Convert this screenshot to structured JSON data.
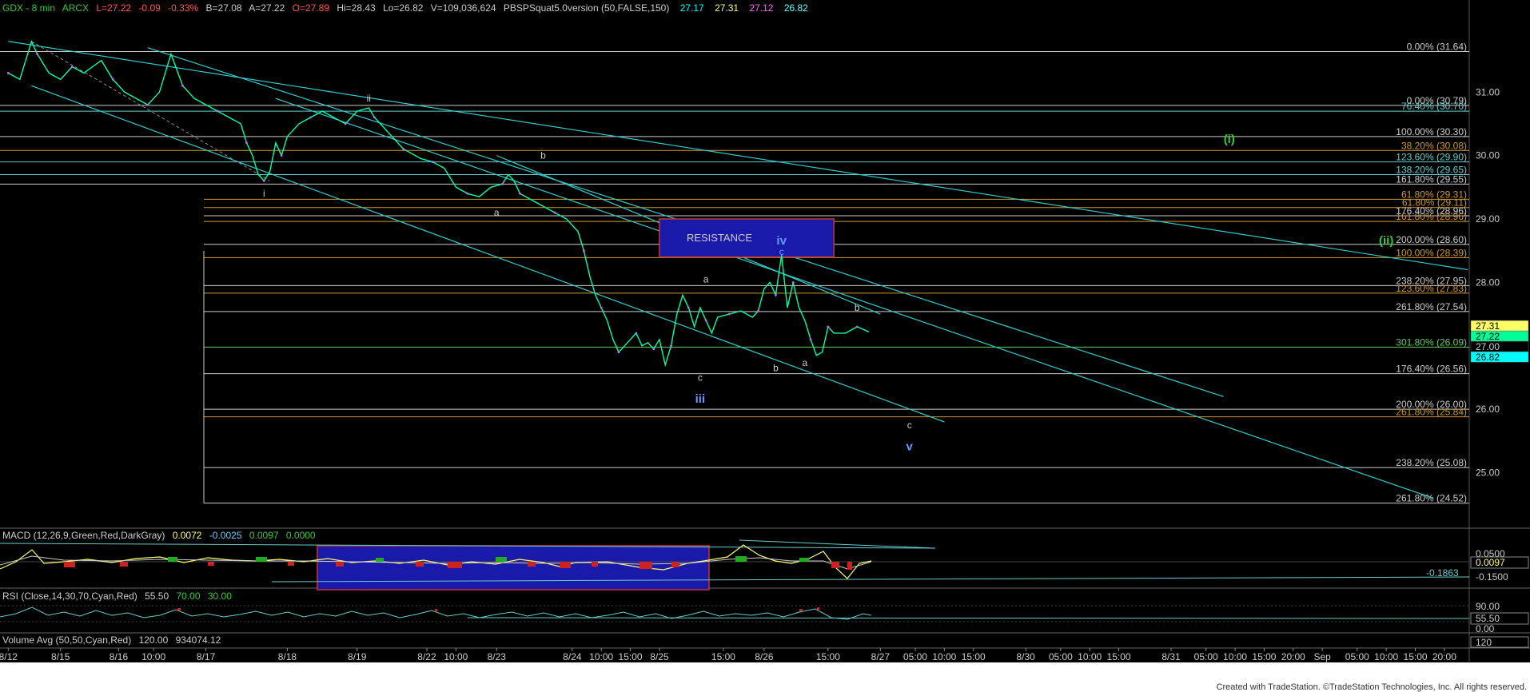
{
  "header": {
    "symbol": "GDX - 8 min",
    "exchange": "ARCX",
    "last": "L=27.22",
    "change": "-0.09",
    "change_pct": "-0.33%",
    "bid": "B=27.08",
    "ask": "A=27.22",
    "open": "O=27.89",
    "high": "Hi=28.43",
    "low": "Lo=26.82",
    "volume": "V=109,036,624",
    "study": "PBSPSquat5.0version (50,FALSE,150)",
    "study_vals": [
      "27.17",
      "27.31",
      "27.12",
      "26.82"
    ],
    "study_colors": [
      "#00ffff",
      "#ffff66",
      "#ff66ff",
      "#66ffff"
    ]
  },
  "chart_data": {
    "type": "line",
    "title": "GDX - 8 min",
    "y_axis": {
      "ylim": [
        24.2,
        32.2
      ],
      "ticks": [
        "31.00",
        "30.00",
        "29.00",
        "28.00",
        "27.00",
        "26.00",
        "25.00"
      ],
      "tick_values": [
        31,
        30,
        29,
        28,
        27,
        26,
        25
      ]
    },
    "x_ticks": [
      "8/12",
      "8/15",
      "8/16",
      "10:00",
      "8/17",
      "8/18",
      "8/19",
      "8/22",
      "10:00",
      "8/23",
      "8/24",
      "10:00",
      "15:00",
      "8/25",
      "15:00",
      "8/26",
      "15:00",
      "8/27",
      "05:00",
      "10:00",
      "15:00",
      "8/30",
      "05:00",
      "10:00",
      "15:00",
      "8/31",
      "05:00",
      "10:00",
      "15:00",
      "20:00",
      "Sep",
      "05:00",
      "10:00",
      "15:00",
      "20:00"
    ],
    "x_tick_values": [
      0,
      9,
      19,
      25,
      34,
      48,
      60,
      72,
      77,
      84,
      97,
      102,
      107,
      112,
      123,
      130,
      141,
      150,
      156,
      161,
      166,
      175,
      181,
      186,
      191,
      200,
      206,
      211,
      216,
      221,
      226,
      232,
      237,
      242,
      247
    ],
    "x_range": [
      -1,
      251
    ],
    "price_series": {
      "name": "GDX",
      "color": "#00ffaa",
      "points": [
        [
          0,
          31.3
        ],
        [
          2,
          31.2
        ],
        [
          4,
          31.8
        ],
        [
          5,
          31.6
        ],
        [
          7,
          31.3
        ],
        [
          9,
          31.2
        ],
        [
          11,
          31.4
        ],
        [
          13,
          31.3
        ],
        [
          16,
          31.5
        ],
        [
          18,
          31.2
        ],
        [
          20,
          31.0
        ],
        [
          22,
          30.9
        ],
        [
          24,
          30.8
        ],
        [
          26,
          31.0
        ],
        [
          28,
          31.6
        ],
        [
          30,
          31.1
        ],
        [
          32,
          30.9
        ],
        [
          34,
          30.8
        ],
        [
          36,
          30.7
        ],
        [
          38,
          30.6
        ],
        [
          40,
          30.5
        ],
        [
          41,
          30.2
        ],
        [
          42,
          30.0
        ],
        [
          43,
          29.7
        ],
        [
          44,
          29.6
        ],
        [
          45,
          29.75
        ],
        [
          46,
          30.2
        ],
        [
          47,
          30.0
        ],
        [
          48,
          30.3
        ],
        [
          50,
          30.5
        ],
        [
          52,
          30.6
        ],
        [
          54,
          30.7
        ],
        [
          56,
          30.6
        ],
        [
          58,
          30.5
        ],
        [
          60,
          30.7
        ],
        [
          62,
          30.75
        ],
        [
          63,
          30.6
        ],
        [
          64,
          30.5
        ],
        [
          66,
          30.3
        ],
        [
          68,
          30.1
        ],
        [
          70,
          30.0
        ],
        [
          71,
          29.95
        ],
        [
          73,
          29.9
        ],
        [
          75,
          29.8
        ],
        [
          77,
          29.5
        ],
        [
          79,
          29.4
        ],
        [
          81,
          29.35
        ],
        [
          83,
          29.5
        ],
        [
          85,
          29.55
        ],
        [
          86,
          29.7
        ],
        [
          87,
          29.6
        ],
        [
          88,
          29.4
        ],
        [
          90,
          29.3
        ],
        [
          92,
          29.2
        ],
        [
          94,
          29.1
        ],
        [
          96,
          29.0
        ],
        [
          98,
          28.8
        ],
        [
          99,
          28.5
        ],
        [
          100,
          28.1
        ],
        [
          101,
          27.8
        ],
        [
          102,
          27.6
        ],
        [
          103,
          27.4
        ],
        [
          104,
          27.1
        ],
        [
          105,
          26.9
        ],
        [
          106,
          27.0
        ],
        [
          107,
          27.1
        ],
        [
          108,
          27.2
        ],
        [
          109,
          27.0
        ],
        [
          110,
          27.05
        ],
        [
          111,
          26.95
        ],
        [
          112,
          27.1
        ],
        [
          113,
          26.7
        ],
        [
          114,
          27.0
        ],
        [
          115,
          27.5
        ],
        [
          116,
          27.8
        ],
        [
          117,
          27.6
        ],
        [
          118,
          27.3
        ],
        [
          119,
          27.6
        ],
        [
          120,
          27.4
        ],
        [
          121,
          27.2
        ],
        [
          122,
          27.45
        ],
        [
          124,
          27.5
        ],
        [
          126,
          27.55
        ],
        [
          128,
          27.45
        ],
        [
          129,
          27.55
        ],
        [
          130,
          27.9
        ],
        [
          131,
          28.0
        ],
        [
          132,
          27.8
        ],
        [
          133,
          28.43
        ],
        [
          134,
          27.6
        ],
        [
          135,
          28.0
        ],
        [
          136,
          27.6
        ],
        [
          137,
          27.4
        ],
        [
          138,
          27.1
        ],
        [
          139,
          26.85
        ],
        [
          140,
          26.9
        ],
        [
          141,
          27.3
        ],
        [
          142,
          27.2
        ],
        [
          144,
          27.2
        ],
        [
          146,
          27.3
        ],
        [
          148,
          27.22
        ]
      ]
    },
    "trendlines": [
      {
        "name": "upper-channel",
        "x": [
          0,
          251
        ],
        "y": [
          31.8,
          28.2
        ]
      },
      {
        "name": "middle-channel",
        "x": [
          24,
          209
        ],
        "y": [
          31.7,
          26.2
        ]
      },
      {
        "name": "lower-channel",
        "x": [
          4,
          161
        ],
        "y": [
          31.1,
          25.8
        ]
      },
      {
        "name": "outer-channel",
        "x": [
          46,
          245
        ],
        "y": [
          30.9,
          24.6
        ]
      },
      {
        "name": "b-line",
        "x": [
          84,
          150
        ],
        "y": [
          30.0,
          27.5
        ]
      }
    ],
    "dashed_line": {
      "x": [
        4,
        45
      ],
      "y": [
        31.8,
        29.6
      ],
      "color": "#888888"
    },
    "fib_levels": [
      {
        "label": "0.00% (31.64)",
        "value": 31.64,
        "color": "#cccccc"
      },
      {
        "label": "0.00% (30.79)",
        "value": 30.79,
        "color": "#cccccc"
      },
      {
        "label": "76.40% (30.70)",
        "value": 30.7,
        "color": "#66cccc"
      },
      {
        "label": "100.00% (30.30)",
        "value": 30.3,
        "color": "#cccccc"
      },
      {
        "label": "38.20% (30.08)",
        "value": 30.08,
        "color": "#cc9933"
      },
      {
        "label": "123.60% (29.90)",
        "value": 29.9,
        "color": "#66cccc"
      },
      {
        "label": "138.20% (29.65)",
        "value": 29.7,
        "color": "#66cccc"
      },
      {
        "label": "161.80% (29.55)",
        "value": 29.55,
        "color": "#cccccc"
      },
      {
        "label": "61.80% (29.31)",
        "value": 29.31,
        "color": "#cc9933"
      },
      {
        "label": "61.80% (29.11)",
        "value": 29.18,
        "color": "#cc9933"
      },
      {
        "label": "176.40% (28.96)",
        "value": 29.05,
        "color": "#cccccc"
      },
      {
        "label": "161.80% (28.96)",
        "value": 28.96,
        "color": "#cc9933"
      },
      {
        "label": "200.00% (28.60)",
        "value": 28.6,
        "color": "#cccccc"
      },
      {
        "label": "100.00% (28.39)",
        "value": 28.39,
        "color": "#cc9933"
      },
      {
        "label": "238.20% (27.95)",
        "value": 27.95,
        "color": "#cccccc"
      },
      {
        "label": "123.60% (27.83)",
        "value": 27.83,
        "color": "#cc9933"
      },
      {
        "label": "261.80% (27.54)",
        "value": 27.54,
        "color": "#cccccc"
      },
      {
        "label": "301.80% (26.09)",
        "value": 26.98,
        "color": "#66cc66"
      },
      {
        "label": "176.40% (26.56)",
        "value": 26.56,
        "color": "#cccccc"
      },
      {
        "label": "200.00% (26.00)",
        "value": 26.0,
        "color": "#cccccc"
      },
      {
        "label": "261.80% (25.84)",
        "value": 25.88,
        "color": "#cc9933"
      },
      {
        "label": "238.20% (25.08)",
        "value": 25.08,
        "color": "#cccccc"
      },
      {
        "label": "261.80% (24.52)",
        "value": 24.52,
        "color": "#cccccc"
      }
    ],
    "resistance_zone": {
      "label": "RESISTANCE",
      "x": [
        112,
        142
      ],
      "y": [
        28.4,
        29.0
      ]
    },
    "wave_labels": [
      {
        "text": "ii",
        "x": 62,
        "y": 30.85,
        "color": "#cccccc"
      },
      {
        "text": "i",
        "x": 44,
        "y": 29.35,
        "color": "#cccccc"
      },
      {
        "text": "b",
        "x": 92,
        "y": 29.95,
        "color": "#cccccc"
      },
      {
        "text": "a",
        "x": 84,
        "y": 29.05,
        "color": "#cccccc"
      },
      {
        "text": "a",
        "x": 120,
        "y": 28.0,
        "color": "#cccccc"
      },
      {
        "text": "c",
        "x": 119,
        "y": 26.45,
        "color": "#cccccc"
      },
      {
        "text": "iii",
        "x": 119,
        "y": 26.1,
        "color": "#6699ff"
      },
      {
        "text": "iv",
        "x": 133,
        "y": 28.6,
        "color": "#6699ff"
      },
      {
        "text": "c",
        "x": 133,
        "y": 28.43,
        "color": "#6699ff"
      },
      {
        "text": "b",
        "x": 146,
        "y": 27.55,
        "color": "#cccccc"
      },
      {
        "text": "b",
        "x": 132,
        "y": 26.6,
        "color": "#cccccc"
      },
      {
        "text": "a",
        "x": 137,
        "y": 26.68,
        "color": "#cccccc"
      },
      {
        "text": "c",
        "x": 155,
        "y": 25.7,
        "color": "#cccccc"
      },
      {
        "text": "v",
        "x": 155,
        "y": 25.35,
        "color": "#6699ff"
      },
      {
        "text": "(i)",
        "x": 210,
        "y": 30.2,
        "color": "#33cc33"
      },
      {
        "text": "(ii)",
        "x": 237,
        "y": 28.6,
        "color": "#33cc33"
      }
    ],
    "price_badges": [
      {
        "text": "27.31",
        "value": 27.31,
        "bg": "#ffff66",
        "fg": "#000000"
      },
      {
        "text": "27.22",
        "value": 27.22,
        "bg": "#00ff99",
        "fg": "#000000"
      },
      {
        "text": "27.00",
        "value": 27.0,
        "bg": "#000000",
        "fg": "#cccccc"
      },
      {
        "text": "26.82",
        "value": 26.82,
        "bg": "#00ffff",
        "fg": "#000000"
      }
    ]
  },
  "macd": {
    "label": "MACD (12,26,9,Green,Red,DarkGray)",
    "values": [
      "0.0072",
      "-0.0025",
      "0.0097",
      "0.0000"
    ],
    "value_colors": [
      "#ffff66",
      "#66ccff",
      "#33cc33",
      "#33cc33"
    ],
    "axis_ticks": [
      "0.0500",
      "0.0097",
      "-0.1500"
    ],
    "extra_label": "-0.1863"
  },
  "rsi": {
    "label": "RSI (Close,14,30,70,Cyan,Red)",
    "values": [
      "55.50",
      "70.00",
      "30.00"
    ],
    "value_colors": [
      "#cccccc",
      "#33cc33",
      "#33cc33"
    ],
    "axis_ticks": [
      "90.00",
      "55.50",
      "0.00"
    ]
  },
  "volume": {
    "label": "Volume Avg (50,50,Cyan,Red)",
    "values": [
      "120.00",
      "934074.12"
    ],
    "value_colors": [
      "#cccccc",
      "#cccccc"
    ],
    "axis_ticks": [
      "120"
    ]
  },
  "footer": "Created with TradeStation. ©TradeStation Technologies, Inc. All rights reserved."
}
